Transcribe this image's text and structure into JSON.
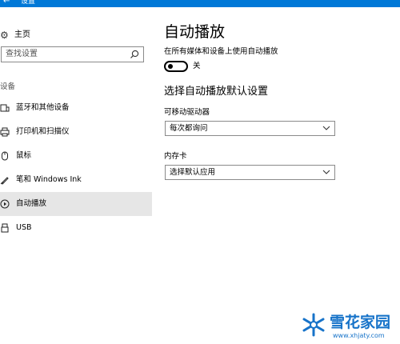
{
  "window": {
    "back_icon": "back-arrow-icon",
    "title": "设置"
  },
  "sidebar": {
    "home": {
      "icon": "gear-icon",
      "label": "主页"
    },
    "search": {
      "placeholder": "查找设置",
      "icon": "search-icon"
    },
    "section_header": "设备",
    "items": [
      {
        "icon": "bluetooth-devices-icon",
        "label": "蓝牙和其他设备",
        "selected": false
      },
      {
        "icon": "printer-icon",
        "label": "打印机和扫描仪",
        "selected": false
      },
      {
        "icon": "mouse-icon",
        "label": "鼠标",
        "selected": false
      },
      {
        "icon": "pen-icon",
        "label": "笔和 Windows Ink",
        "selected": false
      },
      {
        "icon": "autoplay-icon",
        "label": "自动播放",
        "selected": true
      },
      {
        "icon": "usb-icon",
        "label": "USB",
        "selected": false
      }
    ]
  },
  "main": {
    "title": "自动播放",
    "toggle_description": "在所有媒体和设备上使用自动播放",
    "toggle": {
      "state": "off",
      "label": "关"
    },
    "defaults_title": "选择自动播放默认设置",
    "removable_drive": {
      "label": "可移动驱动器",
      "selected": "每次都询问"
    },
    "memory_card": {
      "label": "内存卡",
      "selected": "选择默认应用"
    }
  },
  "watermark": {
    "text": "雪花家园",
    "url": "www.xhjaty.com"
  },
  "colors": {
    "accent": "#0078d7",
    "selected_bg": "#e6e6e6",
    "watermark": "#1773c9"
  }
}
